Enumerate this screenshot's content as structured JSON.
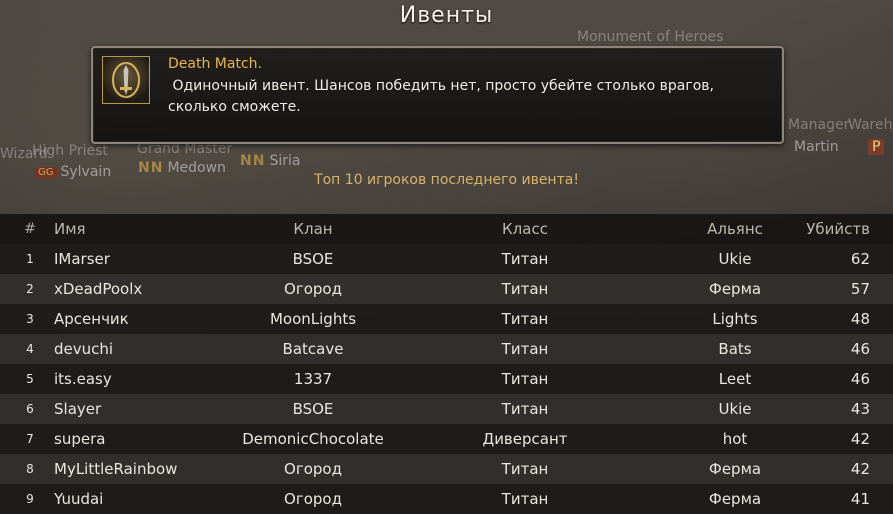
{
  "title": "Ивенты",
  "scene": {
    "monument": "Monument of Heroes",
    "high_priest": "High Priest",
    "grand_master": "Grand Master",
    "wizard": "Wizard",
    "manager": "Manager",
    "warehouse": "Wareh",
    "player1_clan": "GG",
    "player1": "Sylvain",
    "player2_clan": "NN",
    "player2": "Medown",
    "player3_clan": "NN",
    "player3": "Siria",
    "player4": "Martin",
    "player4_tag": "P"
  },
  "event": {
    "name": "Death Match.",
    "description": " Одиночный ивент. Шансов победить нет, просто убейте столько врагов, сколько сможете."
  },
  "caption": "Топ 10 игроков последнего ивента!",
  "table": {
    "headers": {
      "num": "#",
      "name": "Имя",
      "clan": "Клан",
      "class": "Класс",
      "alliance": "Альянс",
      "kills": "Убийств"
    },
    "rows": [
      {
        "num": "1",
        "name": "IMarser",
        "clan": "BSOE",
        "class": "Титан",
        "alliance": "Ukie",
        "kills": "62"
      },
      {
        "num": "2",
        "name": "xDeadPoolx",
        "clan": "Огород",
        "class": "Титан",
        "alliance": "Ферма",
        "kills": "57"
      },
      {
        "num": "3",
        "name": "Арсенчик",
        "clan": "MoonLights",
        "class": "Титан",
        "alliance": "Lights",
        "kills": "48"
      },
      {
        "num": "4",
        "name": "devuchi",
        "clan": "Batcave",
        "class": "Титан",
        "alliance": "Bats",
        "kills": "46"
      },
      {
        "num": "5",
        "name": "its.easy",
        "clan": "1337",
        "class": "Титан",
        "alliance": "Leet",
        "kills": "46"
      },
      {
        "num": "6",
        "name": "Slayer",
        "clan": "BSOE",
        "class": "Титан",
        "alliance": "Ukie",
        "kills": "43"
      },
      {
        "num": "7",
        "name": "supera",
        "clan": "DemonicChocolate",
        "class": "Диверсант",
        "alliance": "hot",
        "kills": "42"
      },
      {
        "num": "8",
        "name": "MyLittleRainbow",
        "clan": "Огород",
        "class": "Титан",
        "alliance": "Ферма",
        "kills": "42"
      },
      {
        "num": "9",
        "name": "Yuudai",
        "clan": "Огород",
        "class": "Титан",
        "alliance": "Ферма",
        "kills": "41"
      }
    ]
  },
  "colors": {
    "event_name": "#e6b54c",
    "caption": "#d8b36b",
    "border": "#8c8578"
  },
  "icons": {
    "event_icon": "sword-event-icon"
  }
}
